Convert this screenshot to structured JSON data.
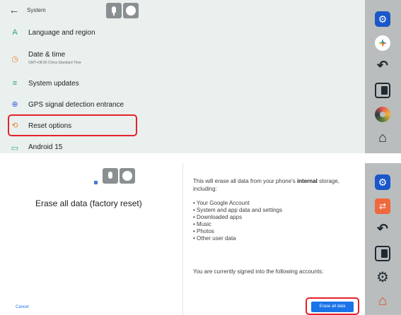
{
  "top_panel": {
    "header": {
      "back_icon": "arrow-left-icon",
      "title": "System"
    },
    "rows": [
      {
        "title": "Language and region",
        "subtitle": "",
        "icon": "language-icon",
        "icon_color": "#2e9f73",
        "glyph": "A"
      },
      {
        "title": "Date & time",
        "subtitle": "GMT+08:00 China Standard Time",
        "icon": "clock-icon",
        "icon_color": "#e8843c",
        "glyph": "◷"
      },
      {
        "title": "System updates",
        "subtitle": "",
        "icon": "update-icon",
        "icon_color": "#2e9f73",
        "glyph": "≡"
      },
      {
        "title": "GPS signal detection entrance",
        "subtitle": "",
        "icon": "gps-icon",
        "icon_color": "#3b5fd9",
        "glyph": "⊕"
      },
      {
        "title": "Reset options",
        "subtitle": "",
        "icon": "reset-icon",
        "icon_color": "#e8843c",
        "glyph": "⟲"
      },
      {
        "title": "Android 15",
        "subtitle": "",
        "icon": "android-icon",
        "icon_color": "#2e9f73",
        "glyph": "▭"
      }
    ]
  },
  "bottom_panel": {
    "heading": "Erase all data (factory reset)",
    "info_intro": "This will erase all data from your phone's",
    "info_intro_bold": "internal",
    "info_intro_end": "storage, including:",
    "items": [
      "• Your Google Account",
      "• System and app data and settings",
      "• Downloaded apps",
      "• Music",
      "• Photos",
      "• Other user data"
    ],
    "signed_in": "You are currently signed into the following accounts:",
    "cancel": "Cancel",
    "erase_button": "Erase all data"
  },
  "colors": {
    "highlight": "#e5222a",
    "accent": "#1a73e8",
    "sidebar": "#b9bdbd"
  }
}
